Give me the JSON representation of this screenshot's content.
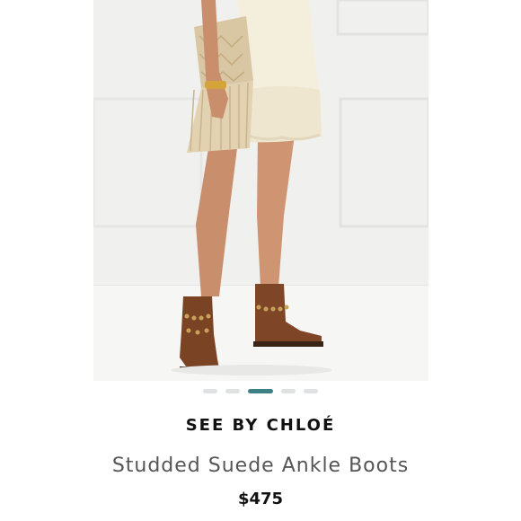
{
  "listing": {
    "brand": "SEE BY CHLOÉ",
    "title": "Studded Suede Ankle Boots",
    "price": "$475"
  },
  "carousel": {
    "total_images": 5,
    "active_index": 2
  },
  "photo": {
    "subject": "product-photo-boots"
  },
  "colors": {
    "accent": "#3f7f86",
    "dot_inactive": "#dfe1e3",
    "boot": "#7a4424"
  }
}
